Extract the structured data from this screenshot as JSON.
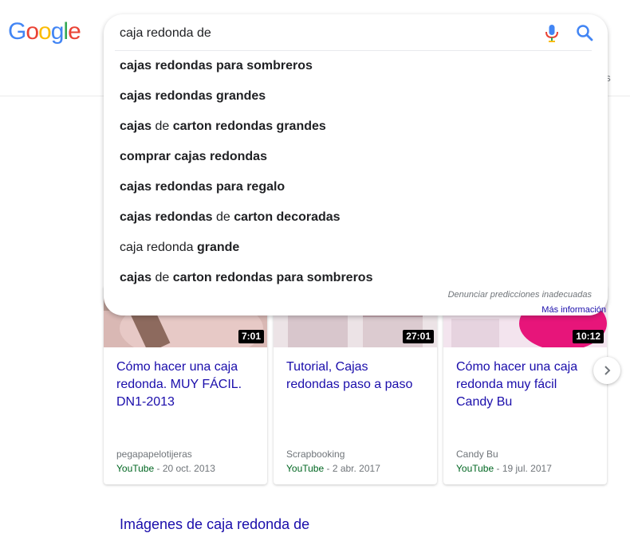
{
  "logo": {
    "letters": [
      "G",
      "o",
      "o",
      "g",
      "l",
      "e"
    ],
    "colors": [
      "#4285F4",
      "#EA4335",
      "#FBBC05",
      "#4285F4",
      "#34A853",
      "#EA4335"
    ]
  },
  "tabs": {
    "partial_right": "as"
  },
  "search": {
    "query": "caja redonda de"
  },
  "suggestions": [
    [
      {
        "t": "cajas redondas para sombreros",
        "b": true
      }
    ],
    [
      {
        "t": "cajas redondas grandes",
        "b": true
      }
    ],
    [
      {
        "t": "cajas",
        "b": true
      },
      {
        "t": " de ",
        "b": false
      },
      {
        "t": "carton redondas grandes",
        "b": true
      }
    ],
    [
      {
        "t": "comprar cajas redondas",
        "b": true
      }
    ],
    [
      {
        "t": "cajas redondas para regalo",
        "b": true
      }
    ],
    [
      {
        "t": "cajas redondas",
        "b": true
      },
      {
        "t": " de ",
        "b": false
      },
      {
        "t": "carton decoradas",
        "b": true
      }
    ],
    [
      {
        "t": "caja redonda ",
        "b": false
      },
      {
        "t": "grande",
        "b": true
      }
    ],
    [
      {
        "t": "cajas",
        "b": true
      },
      {
        "t": " de ",
        "b": false
      },
      {
        "t": "carton redondas para sombreros",
        "b": true
      }
    ]
  ],
  "autocomplete_footer": {
    "report": "Denunciar predicciones inadecuadas",
    "more_info": "Más información"
  },
  "videos": [
    {
      "duration": "7:01",
      "title": "Cómo hacer una caja redonda. MUY FÁCIL. DN1-2013",
      "channel": "pegapapelotijeras",
      "source": "YouTube",
      "date": " - 20 oct. 2013"
    },
    {
      "duration": "27:01",
      "title": "Tutorial, Cajas redondas paso a paso",
      "channel": "Scrapbooking",
      "source": "YouTube",
      "date": " - 2 abr. 2017"
    },
    {
      "duration": "10:12",
      "title": "Cómo hacer una caja redonda muy fácil Candy Bu",
      "channel": "Candy Bu",
      "source": "YouTube",
      "date": " - 19 jul. 2017"
    }
  ],
  "images_heading": "Imágenes de caja redonda de",
  "colors": {
    "link": "#1a0dab",
    "url_green": "#006621",
    "muted": "#70757a"
  }
}
